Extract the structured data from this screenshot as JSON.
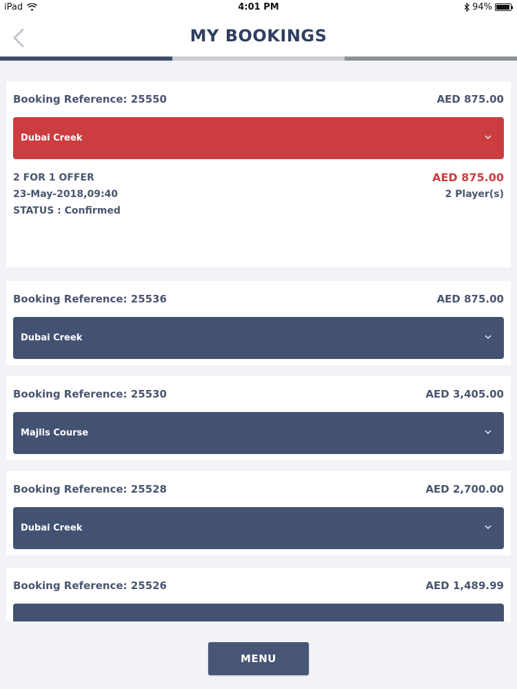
{
  "status_bar": {
    "carrier": "iPad",
    "time": "4:01 PM",
    "battery": "94%"
  },
  "header": {
    "title": "MY BOOKINGS"
  },
  "progress_colors": [
    "#3f4d6b",
    "#c9cbd0",
    "#8d9097"
  ],
  "colors": {
    "active": "#cb3d3f",
    "collapsed": "#435272"
  },
  "bookings": [
    {
      "reference": "Booking Reference: 25550",
      "price": "AED 875.00",
      "course": "Dubai Creek",
      "expanded": true,
      "offer": "2 FOR 1 OFFER",
      "datetime": "23-May-2018,09:40",
      "status": "STATUS :  Confirmed",
      "total": "AED 875.00",
      "players": "2 Player(s)"
    },
    {
      "reference": "Booking Reference: 25536",
      "price": "AED 875.00",
      "course": "Dubai Creek",
      "expanded": false
    },
    {
      "reference": "Booking Reference: 25530",
      "price": "AED 3,405.00",
      "course": "Majlis Course",
      "expanded": false
    },
    {
      "reference": "Booking Reference: 25528",
      "price": "AED 2,700.00",
      "course": "Dubai Creek",
      "expanded": false
    },
    {
      "reference": "Booking Reference: 25526",
      "price": "AED 1,489.99",
      "course": "",
      "expanded": false
    }
  ],
  "footer": {
    "menu_label": "MENU"
  }
}
